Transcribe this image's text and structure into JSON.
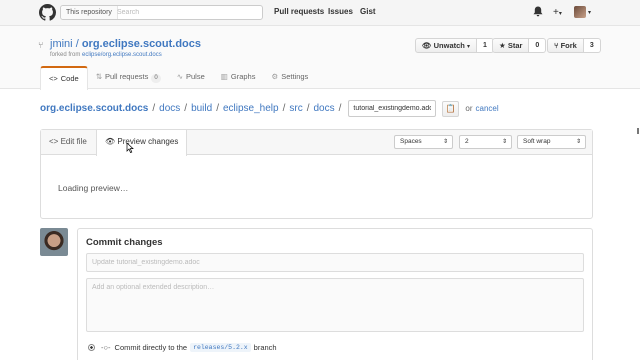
{
  "header": {
    "search_scope": "This repository",
    "search_placeholder": "Search",
    "nav": [
      "Pull requests",
      "Issues",
      "Gist"
    ],
    "icons": [
      "github-logo-icon",
      "bell-icon",
      "plus-icon",
      "caret-down-icon"
    ]
  },
  "repo": {
    "owner": "jmini",
    "name": "org.eclipse.scout.docs",
    "fork_prefix": "forked from ",
    "fork_source": "eclipse/org.eclipse.scout.docs",
    "unwatch_label": "Unwatch",
    "unwatch_count": "1",
    "star_label": "Star",
    "star_count": "0",
    "fork_label": "Fork",
    "fork_count": "3",
    "tabs": {
      "code": "Code",
      "pulls": "Pull requests",
      "pulls_count": "0",
      "pulse": "Pulse",
      "graphs": "Graphs",
      "settings": "Settings"
    }
  },
  "breadcrumb": {
    "root": "org.eclipse.scout.docs",
    "parts": [
      "docs",
      "build",
      "eclipse_help",
      "src",
      "docs"
    ],
    "filename": "tutorial_existingdemo.adoc",
    "or": "or",
    "cancel": "cancel"
  },
  "editor": {
    "tab_edit": "Edit file",
    "tab_preview": "Preview changes",
    "indent_mode": "Spaces",
    "indent_size": "2",
    "wrap_mode": "Soft wrap",
    "loading": "Loading preview…"
  },
  "commit": {
    "title": "Commit changes",
    "message_placeholder": "Update tutorial_existingdemo.adoc",
    "description_placeholder": "Add an optional extended description…",
    "radio_prefix": "Commit directly to the",
    "branch": "releases/5.2.x",
    "radio_suffix": "branch"
  },
  "colors": {
    "link": "#4078c0",
    "active_tab": "#d26911"
  }
}
